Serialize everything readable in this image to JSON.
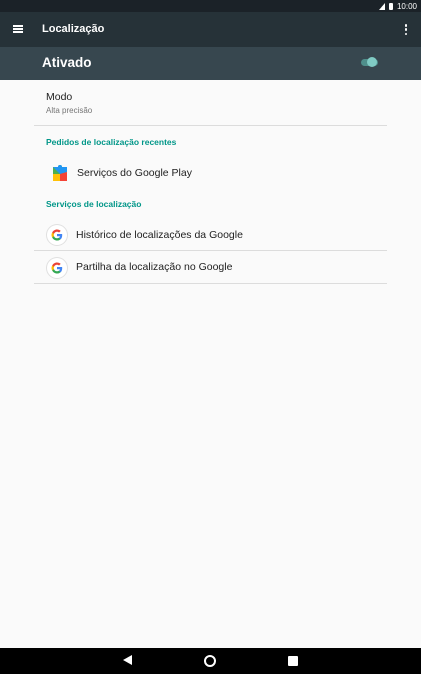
{
  "status_bar": {
    "time": "10:00"
  },
  "toolbar": {
    "title": "Localização"
  },
  "master_switch": {
    "label": "Ativado",
    "enabled": true,
    "accent_color": "#80cbc4"
  },
  "mode": {
    "title": "Modo",
    "summary": "Alta precisão"
  },
  "recent_requests": {
    "header": "Pedidos de localização recentes",
    "items": [
      {
        "label": "Serviços do Google Play",
        "icon": "google-play-services-icon"
      }
    ]
  },
  "location_services": {
    "header": "Serviços de localização",
    "items": [
      {
        "label": "Histórico de localizações da Google",
        "icon": "google-g-icon"
      },
      {
        "label": "Partilha da localização no Google",
        "icon": "google-g-icon"
      }
    ]
  },
  "colors": {
    "toolbar": "#263238",
    "switch_bar": "#37474f",
    "category": "#009688"
  }
}
